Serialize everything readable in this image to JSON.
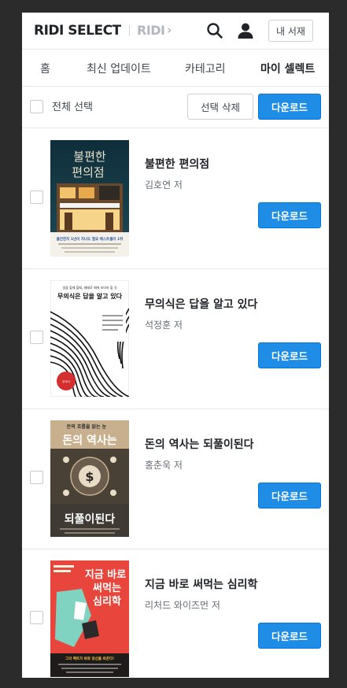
{
  "header": {
    "logo": "RIDI SELECT",
    "ridi_link": "RIDI",
    "ridi_chevron": "›",
    "library_button": "내 서재"
  },
  "tabs": [
    {
      "label": "홈"
    },
    {
      "label": "최신 업데이트"
    },
    {
      "label": "카테고리"
    },
    {
      "label": "마이 셀렉트"
    }
  ],
  "toolbar": {
    "select_all": "전체 선택",
    "delete_selected": "선택 삭제",
    "download": "다운로드"
  },
  "books": [
    {
      "title": "불편한 편의점",
      "author": "김호연 저",
      "download": "다운로드",
      "cover_text": "불편한 편의점",
      "cover_note": "출간한지 1년이 지나도 필요 베스트셀러 1위"
    },
    {
      "title": "무의식은 답을 알고 있다",
      "author": "석정훈 저",
      "download": "다운로드",
      "cover_text": "무의식은 답을 알고 있다",
      "cover_top": "일을 할 때 할때, 때때로 때에 보아야 할 것",
      "cover_badge": "무의식과 함께하는 마음의 조율"
    },
    {
      "title": "돈의 역사는 되풀이된다",
      "author": "홍춘욱 저",
      "download": "다운로드",
      "cover_top": "돈의 흐름을 읽는 눈",
      "cover_line1": "돈의 역사는",
      "cover_line2": "되풀이된다"
    },
    {
      "title": "지금 바로 써먹는 심리학",
      "author": "리처드 와이즈먼 저",
      "download": "다운로드",
      "cover_line1": "지금 바로",
      "cover_line2": "써먹는",
      "cover_line3": "심리학",
      "cover_band": "그의 팩트가 바로 당신을 바꾼다!"
    }
  ],
  "colors": {
    "accent": "#1f8ce6",
    "text": "#1f2226",
    "border": "#e6e8eb"
  }
}
